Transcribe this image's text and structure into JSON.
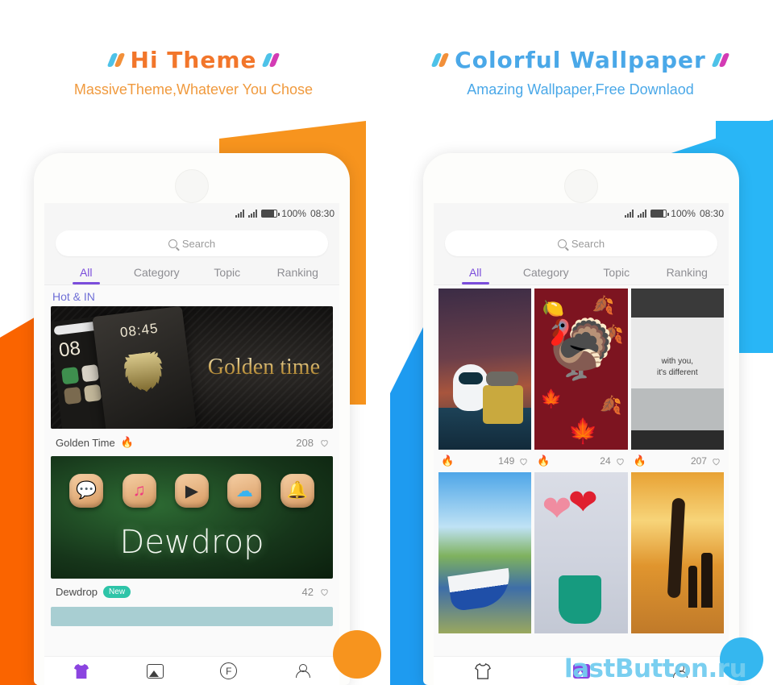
{
  "headers": {
    "left": {
      "title": "Hi Theme",
      "subtitle": "MassiveTheme,Whatever You Chose"
    },
    "right": {
      "title": "Colorful Wallpaper",
      "subtitle": "Amazing Wallpaper,Free Downlaod"
    }
  },
  "colors": {
    "orange": "#f7941e",
    "orange_deep": "#fa6400",
    "blue": "#29b6f6",
    "blue_deep": "#1e9bf0",
    "accent_purple": "#7b4ddb",
    "title_orange": "#f2762b",
    "title_blue": "#4aa8e8",
    "badge_green": "#2ec4a8",
    "watermark_blue": "#73cdf0"
  },
  "statusbar": {
    "battery": "100%",
    "time": "08:30"
  },
  "search": {
    "placeholder": "Search",
    "icon": "search-icon"
  },
  "tabs": [
    {
      "label": "All",
      "active": true
    },
    {
      "label": "Category",
      "active": false
    },
    {
      "label": "Topic",
      "active": false
    },
    {
      "label": "Ranking",
      "active": false
    }
  ],
  "theme_phone": {
    "section_title": "Hot & IN",
    "cards": [
      {
        "name": "Golden Time",
        "artwork_text": "Golden time",
        "lock_time": "08:45",
        "home_time": "08",
        "badge": "",
        "hot": true,
        "likes": "208"
      },
      {
        "name": "Dewdrop",
        "artwork_text": "Dewdrop",
        "badge": "New",
        "hot": false,
        "likes": "42",
        "icons": [
          "chat-icon",
          "music-icon",
          "video-icon",
          "weather-icon",
          "bell-icon"
        ]
      }
    ],
    "nav": [
      {
        "icon": "shirt-icon",
        "active": true
      },
      {
        "icon": "gallery-icon",
        "active": false
      },
      {
        "icon": "font-icon",
        "label": "F",
        "active": false
      },
      {
        "icon": "person-icon",
        "active": false
      }
    ]
  },
  "wallpaper_phone": {
    "rows": [
      [
        {
          "art": "walle",
          "hot": true,
          "likes": "149"
        },
        {
          "art": "turkey",
          "hot": true,
          "likes": "24"
        },
        {
          "art": "bw-cliff",
          "hot": true,
          "likes": "207",
          "caption_line1": "with you,",
          "caption_line2": "it's different"
        }
      ],
      [
        {
          "art": "boat-lake"
        },
        {
          "art": "heart-lollipops"
        },
        {
          "art": "surfers-sunset"
        }
      ]
    ],
    "nav": [
      {
        "icon": "shirt-icon",
        "active": false
      },
      {
        "icon": "gallery-icon",
        "active": true
      },
      {
        "icon": "person-icon",
        "active": false
      }
    ]
  },
  "watermark": "lastButton.ru"
}
